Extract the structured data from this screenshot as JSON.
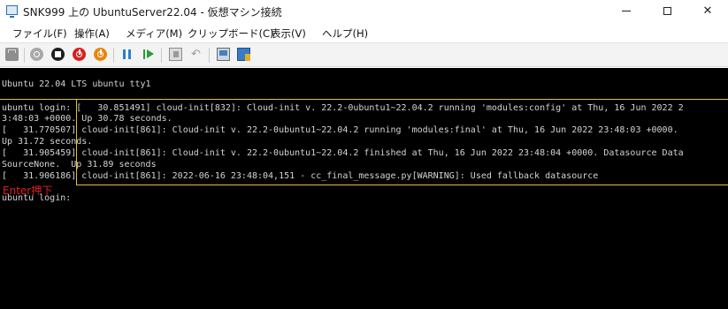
{
  "window": {
    "title": "SNK999 上の UbuntuServer22.04 - 仮想マシン接続"
  },
  "menu": {
    "items": [
      "ファイル(F)",
      "操作(A)",
      "メディア(M)",
      "クリップボード(C)",
      "表示(V)",
      "ヘルプ(H)"
    ]
  },
  "toolbar": {
    "icons": [
      "ctrl-alt-del-icon",
      "start-icon",
      "turn-off-icon",
      "shutdown-icon",
      "save-state-icon",
      "pause-icon",
      "reset-icon",
      "checkpoint-icon",
      "revert-icon",
      "enhanced-session-icon",
      "share-icon"
    ]
  },
  "console": {
    "lines": [
      "Ubuntu 22.04 LTS ubuntu tty1",
      "ubuntu login: [   30.851491] cloud-init[832]: Cloud-init v. 22.2-0ubuntu1~22.04.2 running 'modules:config' at Thu, 16 Jun 2022 2",
      "3:48:03 +0000. Up 30.78 seconds.",
      "[   31.770507] cloud-init[861]: Cloud-init v. 22.2-0ubuntu1~22.04.2 running 'modules:final' at Thu, 16 Jun 2022 23:48:03 +0000.",
      "Up 31.72 seconds.",
      "[   31.905459] cloud-init[861]: Cloud-init v. 22.2-0ubuntu1~22.04.2 finished at Thu, 16 Jun 2022 23:48:04 +0000. Datasource Data",
      "SourceNone.  Up 31.89 seconds",
      "[   31.906186] cloud-init[861]: 2022-06-16 23:48:04,151 - cc_final_message.py[WARNING]: Used fallback datasource",
      "ubuntu login:"
    ],
    "annotation": "Enter押下"
  },
  "colors": {
    "console_bg": "#000000",
    "console_text": "#d4d4d4",
    "highlight": "#e0c040",
    "annotation": "#e02020"
  }
}
